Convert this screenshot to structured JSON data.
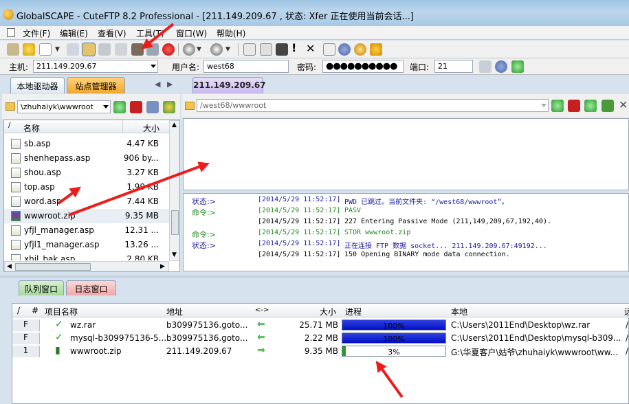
{
  "window": {
    "title": "GlobalSCAPE - CuteFTP 8.2 Professional - [211.149.209.67 , 状态: Xfer 正在使用当前会话...]"
  },
  "menu": [
    "文件(F)",
    "编辑(E)",
    "查看(V)",
    "工具(T)",
    "窗口(W)",
    "帮助(H)"
  ],
  "connection": {
    "host_label": "主机:",
    "host": "211.149.209.67",
    "user_label": "用户名:",
    "user": "west68",
    "pass_label": "密码:",
    "port_label": "端口:",
    "port": "21"
  },
  "local": {
    "tabs": [
      "本地驱动器",
      "站点管理器"
    ],
    "path": "\\zhuhaiyk\\wwwroot",
    "col_name": "名称",
    "col_size": "大小",
    "files": [
      {
        "name": "sb.asp",
        "size": "4.47 KB"
      },
      {
        "name": "shenhepass.asp",
        "size": "906 by..."
      },
      {
        "name": "shou.asp",
        "size": "3.27 KB"
      },
      {
        "name": "top.asp",
        "size": "1.99 KB"
      },
      {
        "name": "word.asp",
        "size": "7.44 KB"
      },
      {
        "name": "wwwroot.zip",
        "size": "9.35 MB"
      },
      {
        "name": "yfjl_manager.asp",
        "size": "12.31 ..."
      },
      {
        "name": "yfjl1_manager.asp",
        "size": "13.26 ..."
      },
      {
        "name": "xhjl_bak.asp",
        "size": "2.80 KB"
      }
    ]
  },
  "remote": {
    "tab": "211.149.209.67",
    "path": "/west68/wwwroot"
  },
  "log": [
    {
      "kind": "状态:>",
      "time": "[2014/5/29 11:52:17]",
      "msg": "PWD 已跳过。当前文件夹: “/west68/wwwroot”。"
    },
    {
      "kind": "命令:>",
      "time": "[2014/5/29 11:52:17]",
      "msg": "PASV"
    },
    {
      "kind": "",
      "time": "[2014/5/29 11:52:17]",
      "msg": "227 Entering Passive Mode (211,149,209,67,192,40)."
    },
    {
      "kind": "命令:>",
      "time": "[2014/5/29 11:52:17]",
      "msg": "STOR wwwroot.zip"
    },
    {
      "kind": "状态:>",
      "time": "[2014/5/29 11:52:17]",
      "msg": "正在连接 FTP 数据 socket... 211.149.209.67:49192..."
    },
    {
      "kind": "",
      "time": "[2014/5/29 11:52:17]",
      "msg": "150 Opening BINARY mode data connection."
    }
  ],
  "queue": {
    "tabs": [
      "队列窗口",
      "日志窗口"
    ],
    "headers": {
      "slash": "/",
      "num": "#",
      "name": "项目名称",
      "addr": "地址",
      "dir": "<->",
      "size": "大小",
      "progress": "进程",
      "local": "本地",
      "extra": "远"
    },
    "rows": [
      {
        "num": "F",
        "name": "wz.rar",
        "addr": "b309975136.goto...",
        "size": "25.71 MB",
        "progress_text": "100%",
        "progress": 1.0,
        "local": "C:\\Users\\2011End\\Desktop\\wz.rar",
        "extra": "/"
      },
      {
        "num": "F",
        "name": "mysql-b309975136-5...",
        "addr": "b309975136.goto...",
        "size": "2.22 MB",
        "progress_text": "100%",
        "progress": 1.0,
        "local": "C:\\Users\\2011End\\Desktop\\mysql-b309...",
        "extra": "/"
      },
      {
        "num": "1",
        "name": "wwwroot.zip",
        "addr": "211.149.209.67",
        "size": "9.35 MB",
        "progress_text": "3%",
        "progress": 0.03,
        "local": "G:\\华夏客户\\姑爷\\zhuhaiyk\\wwwroot\\ww...",
        "extra": "/"
      }
    ]
  },
  "colors": {
    "accent": "#ff2020",
    "tab_active": "#f0b83c",
    "queue_fill": "#1020d8"
  }
}
